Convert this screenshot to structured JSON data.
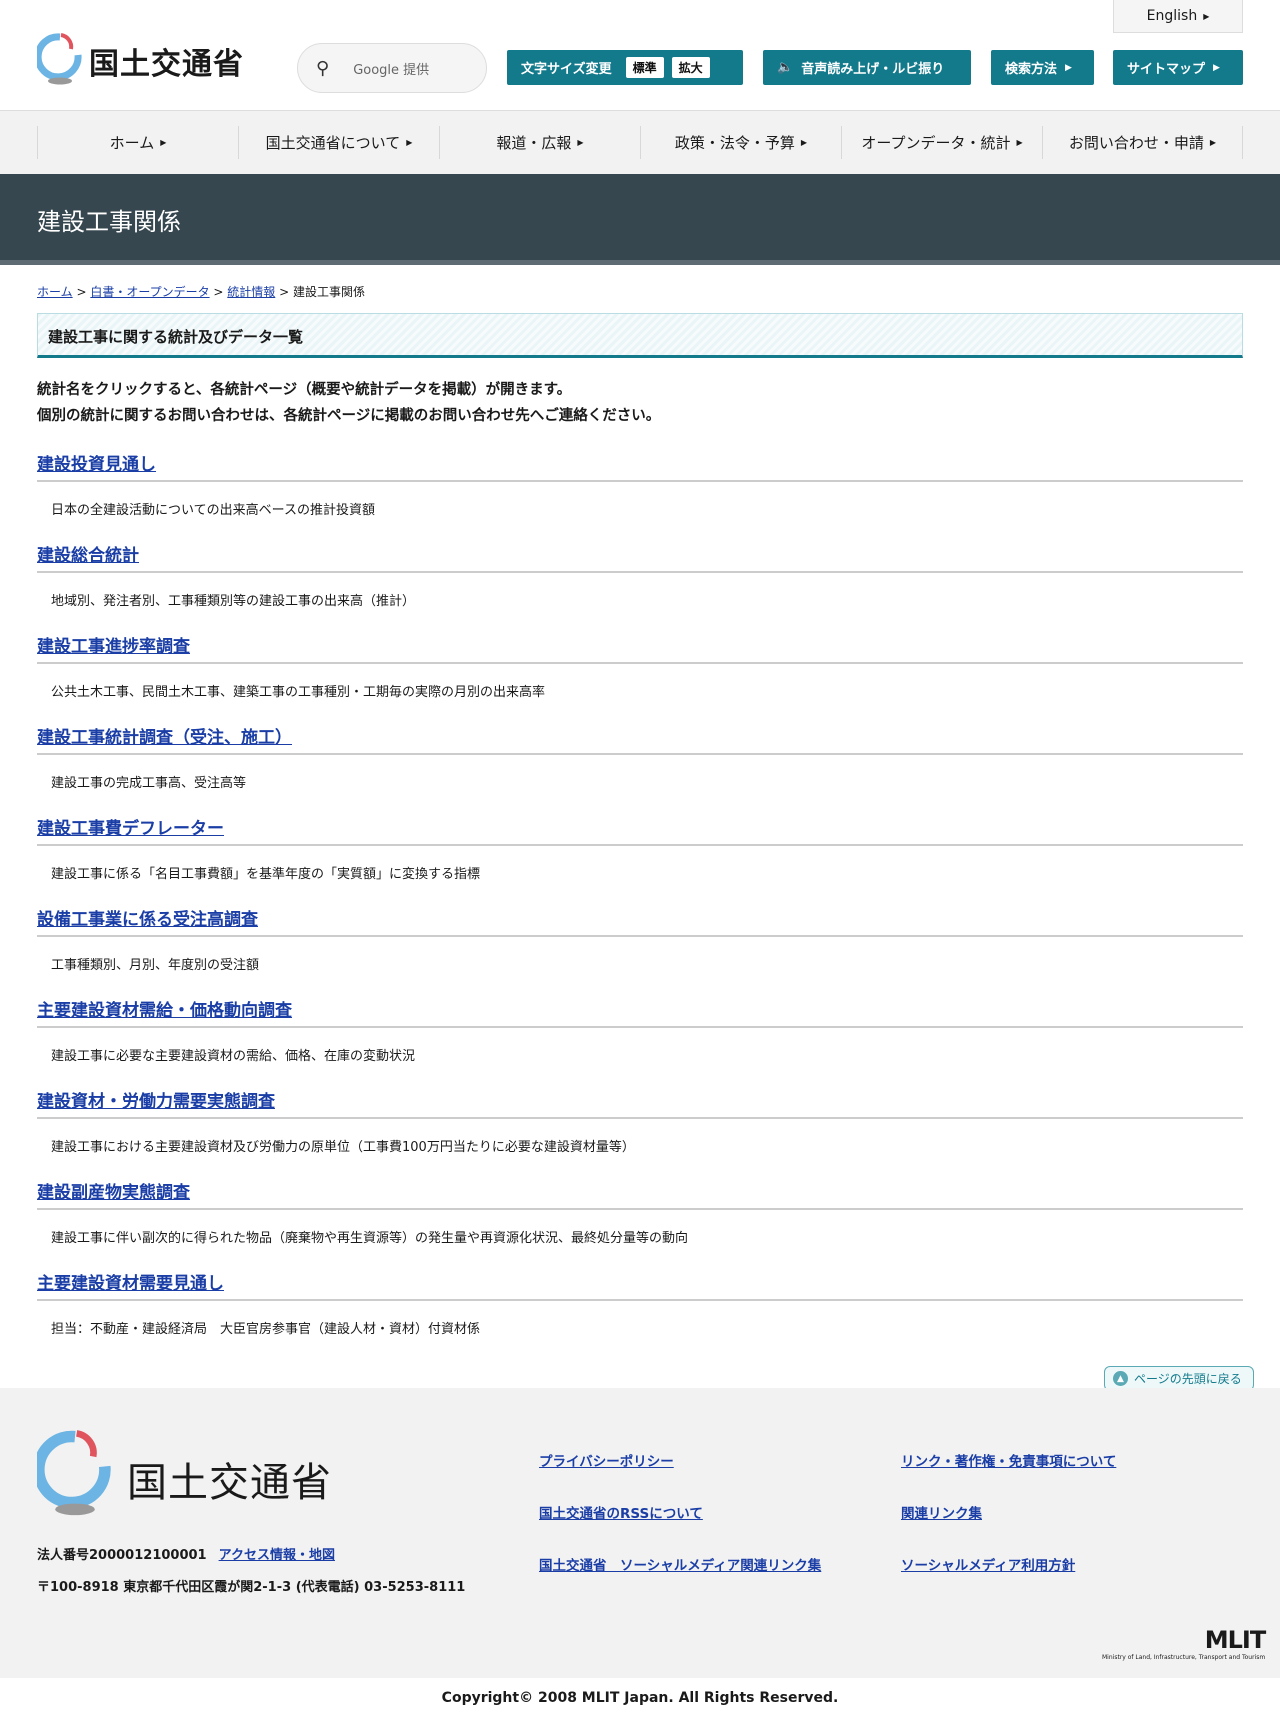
{
  "header": {
    "logo_text": "国土交通省",
    "search_label": "Google 提供",
    "font_size_label": "文字サイズ変更",
    "font_standard": "標準",
    "font_large": "拡大",
    "speech_label": "音声読み上げ・ルビ振り",
    "search_method": "検索方法",
    "sitemap": "サイトマップ",
    "english": "English"
  },
  "nav": [
    "ホーム",
    "国土交通省について",
    "報道・広報",
    "政策・法令・予算",
    "オープンデータ・統計",
    "お問い合わせ・申請"
  ],
  "page_title": "建設工事関係",
  "breadcrumb": [
    "ホーム",
    "白書・オープンデータ",
    "統計情報",
    "建設工事関係"
  ],
  "section_heading": "建設工事に関する統計及びデータ一覧",
  "intro": [
    "統計名をクリックすると、各統計ページ（概要や統計データを掲載）が開きます。",
    "個別の統計に関するお問い合わせは、各統計ページに掲載のお問い合わせ先へご連絡ください。"
  ],
  "items": [
    {
      "title": "建設投資見通し",
      "desc": "日本の全建設活動についての出来高ベースの推計投資額"
    },
    {
      "title": "建設総合統計",
      "desc": "地域別、発注者別、工事種類別等の建設工事の出来高（推計）"
    },
    {
      "title": "建設工事進捗率調査",
      "desc": "公共土木工事、民間土木工事、建築工事の工事種別・工期毎の実際の月別の出来高率"
    },
    {
      "title": "建設工事統計調査（受注、施工）",
      "desc": "建設工事の完成工事高、受注高等"
    },
    {
      "title": "建設工事費デフレーター",
      "desc": "建設工事に係る「名目工事費額」を基準年度の「実質額」に変換する指標"
    },
    {
      "title": "設備工事業に係る受注高調査",
      "desc": "工事種類別、月別、年度別の受注額"
    },
    {
      "title": "主要建設資材需給・価格動向調査",
      "desc": "建設工事に必要な主要建設資材の需給、価格、在庫の変動状況"
    },
    {
      "title": "建設資材・労働力需要実態調査",
      "desc": "建設工事における主要建設資材及び労働力の原単位（工事費100万円当たりに必要な建設資材量等）"
    },
    {
      "title": "建設副産物実態調査",
      "desc": "建設工事に伴い副次的に得られた物品（廃棄物や再生資源等）の発生量や再資源化状況、最終処分量等の動向"
    },
    {
      "title": "主要建設資材需要見通し",
      "desc": "担当：不動産・建設経済局　大臣官房参事官（建設人材・資材）付資材係"
    }
  ],
  "back_to_top": "ページの先頭に戻る",
  "footer": {
    "logo_text": "国土交通省",
    "corp_number": "法人番号2000012100001",
    "access": "アクセス情報・地図",
    "address": "〒100-8918 東京都千代田区霞が関2-1-3 (代表電話) 03-5253-8111",
    "links": [
      "プライバシーポリシー",
      "リンク・著作権・免責事項について",
      "国土交通省のRSSについて",
      "関連リンク集",
      "国土交通省　ソーシャルメディア関連リンク集",
      "ソーシャルメディア利用方針"
    ],
    "mlit": "MLIT",
    "mlit_sub": "Ministry of Land, Infrastructure, Transport and Tourism",
    "copyright": "Copyright© 2008 MLIT Japan. All Rights Reserved."
  }
}
